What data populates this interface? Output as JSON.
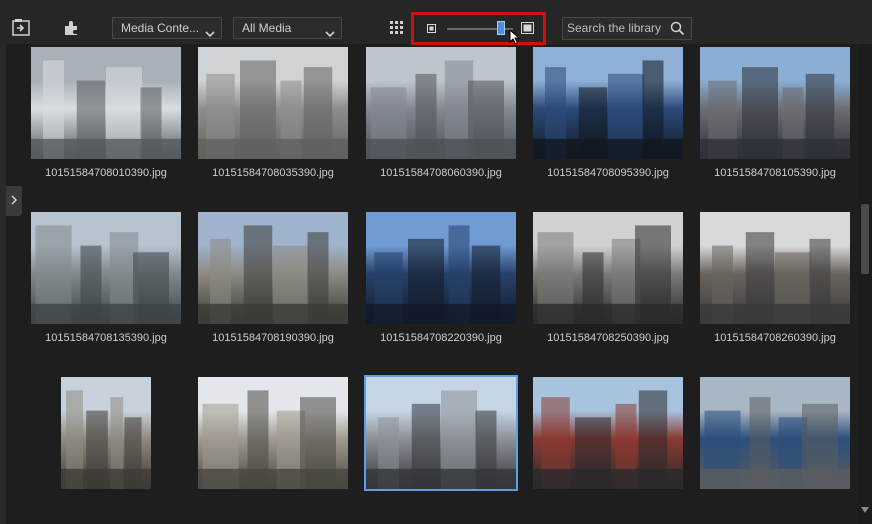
{
  "toolbar": {
    "import_icon": "import-media-icon",
    "plugin_icon": "plugin-icon",
    "category_dropdown": "Media Conte...",
    "filter_dropdown": "All Media",
    "view_grid_icon": "grid-view-icon",
    "zoom_slider_value": 0.82,
    "search_placeholder": "Search the library"
  },
  "library": {
    "items": [
      {
        "filename": "10151584708010390.jpg",
        "selected": false,
        "colors": [
          "#a9b1b8",
          "#d9dde0",
          "#555a5e"
        ]
      },
      {
        "filename": "10151584708035390.jpg",
        "selected": false,
        "colors": [
          "#cfd3d6",
          "#8e8f8d",
          "#62605c"
        ]
      },
      {
        "filename": "10151584708060390.jpg",
        "selected": false,
        "colors": [
          "#bfc5cc",
          "#838891",
          "#4e5358"
        ]
      },
      {
        "filename": "10151584708095390.jpg",
        "selected": false,
        "colors": [
          "#8fb0d6",
          "#2c4a7a",
          "#111820"
        ]
      },
      {
        "filename": "10151584708105390.jpg",
        "selected": false,
        "colors": [
          "#8aaed4",
          "#6b6e72",
          "#2e3238"
        ]
      },
      {
        "filename": "10151584708135390.jpg",
        "selected": false,
        "colors": [
          "#b7c2cf",
          "#7f8a8d",
          "#3d4346"
        ]
      },
      {
        "filename": "10151584708190390.jpg",
        "selected": false,
        "colors": [
          "#9fb3cc",
          "#8d8a83",
          "#3d3b37"
        ]
      },
      {
        "filename": "10151584708220390.jpg",
        "selected": false,
        "colors": [
          "#6f9ad2",
          "#27426a",
          "#121a28"
        ]
      },
      {
        "filename": "10151584708250390.jpg",
        "selected": false,
        "colors": [
          "#cfd2d5",
          "#7c7a76",
          "#2b2b2a"
        ]
      },
      {
        "filename": "10151584708260390.jpg",
        "selected": false,
        "colors": [
          "#d7d9dc",
          "#6a645e",
          "#3a3a3b"
        ]
      },
      {
        "filename": "",
        "selected": false,
        "colors": [
          "#c7d2dc",
          "#8f8a80",
          "#3e3b37"
        ]
      },
      {
        "filename": "",
        "selected": false,
        "colors": [
          "#e3e6ea",
          "#a09a90",
          "#4a4742"
        ]
      },
      {
        "filename": "",
        "selected": true,
        "colors": [
          "#c6d5e6",
          "#8d9197",
          "#33373b"
        ]
      },
      {
        "filename": "",
        "selected": false,
        "colors": [
          "#a8c3de",
          "#8a3a32",
          "#2a2a2c"
        ]
      },
      {
        "filename": "",
        "selected": false,
        "colors": [
          "#a9b7c4",
          "#2c4f7b",
          "#5a5c60"
        ]
      }
    ]
  },
  "expander_icon": "chevron-right-icon",
  "scroll_position": 0.35
}
